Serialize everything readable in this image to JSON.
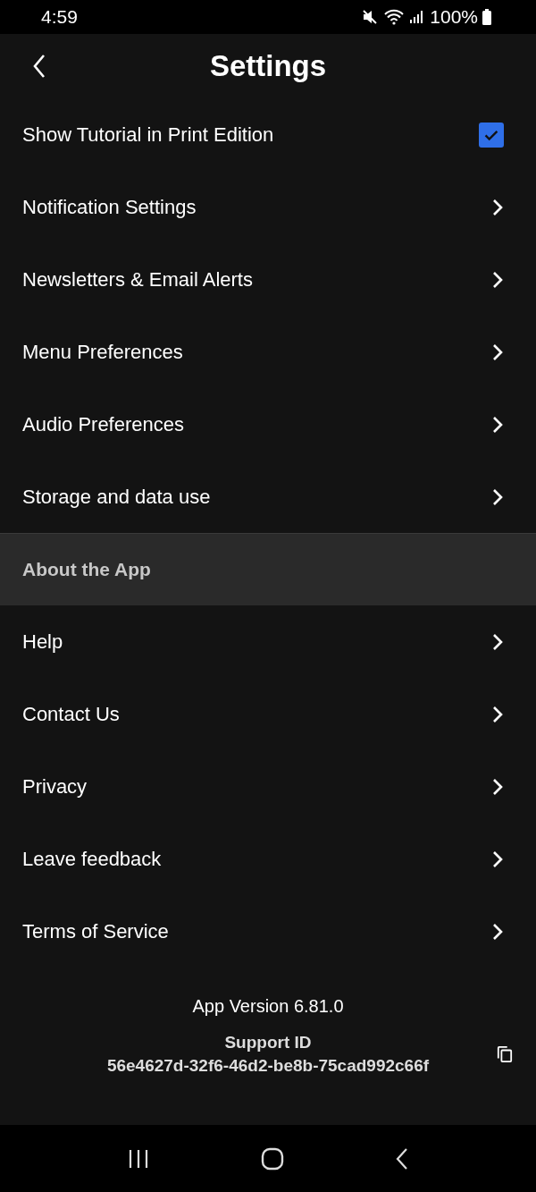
{
  "status_bar": {
    "time": "4:59",
    "battery": "100%"
  },
  "header": {
    "title": "Settings"
  },
  "settings": [
    {
      "kind": "checkbox",
      "label": "Show Tutorial in Print Edition",
      "checked": true
    },
    {
      "kind": "link",
      "label": "Notification Settings"
    },
    {
      "kind": "link",
      "label": "Newsletters & Email Alerts"
    },
    {
      "kind": "link",
      "label": "Menu Preferences"
    },
    {
      "kind": "link",
      "label": "Audio Preferences"
    },
    {
      "kind": "link",
      "label": "Storage and data use"
    }
  ],
  "about": {
    "title": "About the App",
    "items": [
      {
        "kind": "link",
        "label": "Help"
      },
      {
        "kind": "link",
        "label": "Contact Us"
      },
      {
        "kind": "link",
        "label": "Privacy"
      },
      {
        "kind": "link",
        "label": "Leave feedback"
      },
      {
        "kind": "link",
        "label": "Terms of Service"
      }
    ]
  },
  "footer": {
    "app_version": "App Version 6.81.0",
    "support_id_label": "Support ID",
    "support_id": "56e4627d-32f6-46d2-be8b-75cad992c66f"
  }
}
